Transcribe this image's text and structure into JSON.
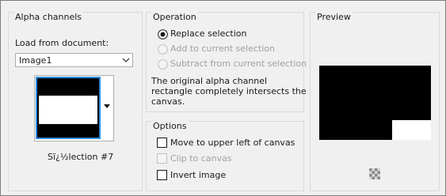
{
  "alpha_channels": {
    "title": "Alpha channels",
    "load_label": "Load from document:",
    "document": "Image1",
    "selection_name": "Sï¿½lection #7"
  },
  "operation": {
    "title": "Operation",
    "options": [
      {
        "label": "Replace selection",
        "selected": true,
        "enabled": true
      },
      {
        "label": "Add to current selection",
        "selected": false,
        "enabled": false
      },
      {
        "label": "Subtract from current selection",
        "selected": false,
        "enabled": false
      }
    ],
    "description_line1": "The original alpha channel",
    "description_line2": "rectangle completely intersects the",
    "description_line3": "canvas."
  },
  "options": {
    "title": "Options",
    "items": [
      {
        "label": "Move to upper left of canvas",
        "checked": false,
        "enabled": true
      },
      {
        "label": "Clip to canvas",
        "checked": false,
        "enabled": false
      },
      {
        "label": "Invert image",
        "checked": false,
        "enabled": true
      }
    ]
  },
  "preview": {
    "title": "Preview"
  },
  "colors": {
    "accent": "#2a8ae0",
    "disabled_text": "#a0a0a0"
  }
}
